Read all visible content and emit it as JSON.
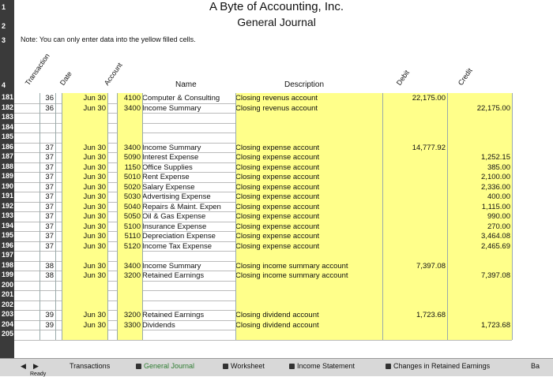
{
  "title": "A Byte of Accounting, Inc.",
  "subtitle": "General Journal",
  "note": "Note: You can only enter data into the yellow filled cells.",
  "column_headers": {
    "transaction": "Transaction",
    "date": "Date",
    "account": "Account",
    "name": "Name",
    "description": "Description",
    "debit": "Debit",
    "credit": "Credit"
  },
  "top_row_numbers": [
    "1",
    "2",
    "3",
    "4"
  ],
  "rows": [
    {
      "num": "181",
      "tx": "36",
      "date": "Jun 30",
      "acct": "4100",
      "name": "Computer & Consulting",
      "desc": "Closing revenus account",
      "debit": "22,175.00",
      "credit": ""
    },
    {
      "num": "182",
      "tx": "36",
      "date": "Jun 30",
      "acct": "3400",
      "name": "Income Summary",
      "desc": "Closing revenus account",
      "debit": "",
      "credit": "22,175.00"
    },
    {
      "num": "183",
      "tx": "",
      "date": "",
      "acct": "",
      "name": "",
      "desc": "",
      "debit": "",
      "credit": ""
    },
    {
      "num": "184",
      "tx": "",
      "date": "",
      "acct": "",
      "name": "",
      "desc": "",
      "debit": "",
      "credit": ""
    },
    {
      "num": "185",
      "tx": "",
      "date": "",
      "acct": "",
      "name": "",
      "desc": "",
      "debit": "",
      "credit": ""
    },
    {
      "num": "186",
      "tx": "37",
      "date": "Jun 30",
      "acct": "3400",
      "name": "Income Summary",
      "desc": "Closing expense account",
      "debit": "14,777.92",
      "credit": ""
    },
    {
      "num": "187",
      "tx": "37",
      "date": "Jun 30",
      "acct": "5090",
      "name": "Interest Expense",
      "desc": "Closing expense account",
      "debit": "",
      "credit": "1,252.15"
    },
    {
      "num": "188",
      "tx": "37",
      "date": "Jun 30",
      "acct": "1150",
      "name": "Office Supplies",
      "desc": "Closing expense account",
      "debit": "",
      "credit": "385.00"
    },
    {
      "num": "189",
      "tx": "37",
      "date": "Jun 30",
      "acct": "5010",
      "name": "Rent Expense",
      "desc": "Closing expense account",
      "debit": "",
      "credit": "2,100.00"
    },
    {
      "num": "190",
      "tx": "37",
      "date": "Jun 30",
      "acct": "5020",
      "name": "Salary Expense",
      "desc": "Closing expense account",
      "debit": "",
      "credit": "2,336.00"
    },
    {
      "num": "191",
      "tx": "37",
      "date": "Jun 30",
      "acct": "5030",
      "name": "Advertising Expense",
      "desc": "Closing expense account",
      "debit": "",
      "credit": "400.00"
    },
    {
      "num": "192",
      "tx": "37",
      "date": "Jun 30",
      "acct": "5040",
      "name": "Repairs & Maint. Expen",
      "desc": "Closing expense account",
      "debit": "",
      "credit": "1,115.00"
    },
    {
      "num": "193",
      "tx": "37",
      "date": "Jun 30",
      "acct": "5050",
      "name": "Oil & Gas Expense",
      "desc": "Closing expense account",
      "debit": "",
      "credit": "990.00"
    },
    {
      "num": "194",
      "tx": "37",
      "date": "Jun 30",
      "acct": "5100",
      "name": "Insurance Expense",
      "desc": "Closing expense account",
      "debit": "",
      "credit": "270.00"
    },
    {
      "num": "195",
      "tx": "37",
      "date": "Jun 30",
      "acct": "5110",
      "name": "Depreciation Expense",
      "desc": "Closing expense account",
      "debit": "",
      "credit": "3,464.08"
    },
    {
      "num": "196",
      "tx": "37",
      "date": "Jun 30",
      "acct": "5120",
      "name": "Income Tax Expense",
      "desc": "Closing expense account",
      "debit": "",
      "credit": "2,465.69"
    },
    {
      "num": "197",
      "tx": "",
      "date": "",
      "acct": "",
      "name": "",
      "desc": "",
      "debit": "",
      "credit": ""
    },
    {
      "num": "198",
      "tx": "38",
      "date": "Jun 30",
      "acct": "3400",
      "name": "Income Summary",
      "desc": "Closing income summary account",
      "debit": "7,397.08",
      "credit": ""
    },
    {
      "num": "199",
      "tx": "38",
      "date": "Jun 30",
      "acct": "3200",
      "name": "Retained Earnings",
      "desc": "Closing income summary account",
      "debit": "",
      "credit": "7,397.08"
    },
    {
      "num": "200",
      "tx": "",
      "date": "",
      "acct": "",
      "name": "",
      "desc": "",
      "debit": "",
      "credit": ""
    },
    {
      "num": "201",
      "tx": "",
      "date": "",
      "acct": "",
      "name": "",
      "desc": "",
      "debit": "",
      "credit": ""
    },
    {
      "num": "202",
      "tx": "",
      "date": "",
      "acct": "",
      "name": "",
      "desc": "",
      "debit": "",
      "credit": ""
    },
    {
      "num": "203",
      "tx": "39",
      "date": "Jun 30",
      "acct": "3200",
      "name": "Retained Earnings",
      "desc": "Closing dividend account",
      "debit": "1,723.68",
      "credit": ""
    },
    {
      "num": "204",
      "tx": "39",
      "date": "Jun 30",
      "acct": "3300",
      "name": "Dividends",
      "desc": "Closing dividend account",
      "debit": "",
      "credit": "1,723.68"
    },
    {
      "num": "205",
      "tx": "",
      "date": "",
      "acct": "",
      "name": "",
      "desc": "",
      "debit": "",
      "credit": ""
    }
  ],
  "tabs": [
    "Transactions",
    "General Journal",
    "Worksheet",
    "Income Statement",
    "Changes in Retained Earnings"
  ],
  "tab_overflow": "Ba",
  "status": "Ready",
  "colors": {
    "yellow": "#ffff8a",
    "header_bg": "#3a3a3a",
    "tab_active": "#2e7d32"
  }
}
